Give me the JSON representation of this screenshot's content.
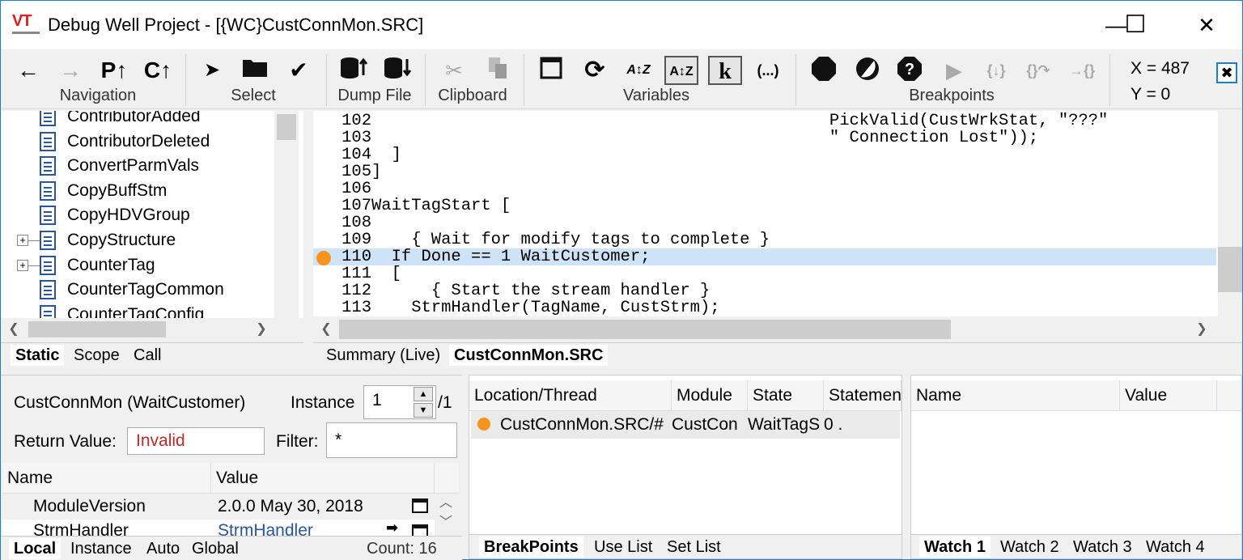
{
  "window": {
    "title": "Debug Well Project - [{WC}CustConnMon.SRC]",
    "logo_text": "VT",
    "minimize": "—",
    "maximize": "☐",
    "close": "✕"
  },
  "toolbar": {
    "groups": {
      "navigation": "Navigation",
      "select": "Select",
      "dump_file": "Dump File",
      "clipboard": "Clipboard",
      "variables": "Variables",
      "breakpoints": "Breakpoints"
    },
    "buttons": {
      "back": "←",
      "forward": "→",
      "p_t": "P↑",
      "c_t": "C↑",
      "pointer": "➤",
      "folder": "▬",
      "check": "✔",
      "k": "k",
      "paren": "(...)"
    },
    "coords": {
      "x_label": "X = 487",
      "y_label": "Y = 0"
    }
  },
  "left_tree": {
    "items": [
      {
        "label": "ContributorAdded",
        "expandable": false
      },
      {
        "label": "ContributorDeleted",
        "expandable": false
      },
      {
        "label": "ConvertParmVals",
        "expandable": false
      },
      {
        "label": "CopyBuffStm",
        "expandable": false
      },
      {
        "label": "CopyHDVGroup",
        "expandable": false
      },
      {
        "label": "CopyStructure",
        "expandable": true
      },
      {
        "label": "CounterTag",
        "expandable": true
      },
      {
        "label": "CounterTagCommon",
        "expandable": false
      },
      {
        "label": "CounterTagConfig",
        "expandable": false
      }
    ],
    "tabs": [
      "Static",
      "Scope",
      "Call"
    ],
    "active_tab": "Static"
  },
  "code_view": {
    "lines": [
      {
        "num": "102",
        "text": "                                              PickValid(CustWrkStat, \"???\""
      },
      {
        "num": "103",
        "text": "                                              \" Connection Lost\"));"
      },
      {
        "num": "104",
        "text": "  ]"
      },
      {
        "num": "105",
        "text": "]"
      },
      {
        "num": "106",
        "text": ""
      },
      {
        "num": "107",
        "text": "WaitTagStart ["
      },
      {
        "num": "108",
        "text": ""
      },
      {
        "num": "109",
        "text": "    { Wait for modify tags to complete }"
      },
      {
        "num": "110",
        "text": "  If Done == 1 WaitCustomer;"
      },
      {
        "num": "111",
        "text": "  ["
      },
      {
        "num": "112",
        "text": "      { Start the stream handler }"
      },
      {
        "num": "113",
        "text": "    StrmHandler(TagName, CustStrm);"
      }
    ],
    "highlight_line": "110",
    "tabs": [
      "Summary (Live)",
      "CustConnMon.SRC"
    ],
    "active_tab": "CustConnMon.SRC"
  },
  "locals_panel": {
    "scope_label": "CustConnMon (WaitCustomer)",
    "instance_label": "Instance",
    "instance_value": "1",
    "instance_total": "/1",
    "return_label": "Return Value:",
    "return_value": "Invalid",
    "filter_label": "Filter:",
    "filter_value": "*",
    "columns": [
      "Name",
      "Value"
    ],
    "rows": [
      {
        "name": "ModuleVersion",
        "value": "2.0.0 May 30, 2018"
      },
      {
        "name": "StrmHandler",
        "value": "StrmHandler"
      }
    ],
    "tabs": [
      "Local",
      "Instance",
      "Auto",
      "Global"
    ],
    "active_tab": "Local",
    "count": "Count: 16"
  },
  "breakpoints_panel": {
    "columns": [
      "Location/Thread",
      "Module",
      "State",
      "Statemen"
    ],
    "rows": [
      {
        "location": "CustConnMon.SRC/#",
        "module": "CustCon",
        "state": "WaitTagS",
        "statement": "0 ."
      }
    ],
    "tabs": [
      "BreakPoints",
      "Use List",
      "Set List"
    ],
    "active_tab": "BreakPoints"
  },
  "watch_panel": {
    "columns": [
      "Name",
      "Value"
    ],
    "tabs": [
      "Watch 1",
      "Watch 2",
      "Watch 3",
      "Watch 4"
    ],
    "active_tab": "Watch 1"
  },
  "colors": {
    "accent": "#1a7fd4",
    "breakpoint": "#f7941d",
    "highlight": "#cfe3f8",
    "invalid": "#c62828",
    "link": "#2855a0"
  }
}
